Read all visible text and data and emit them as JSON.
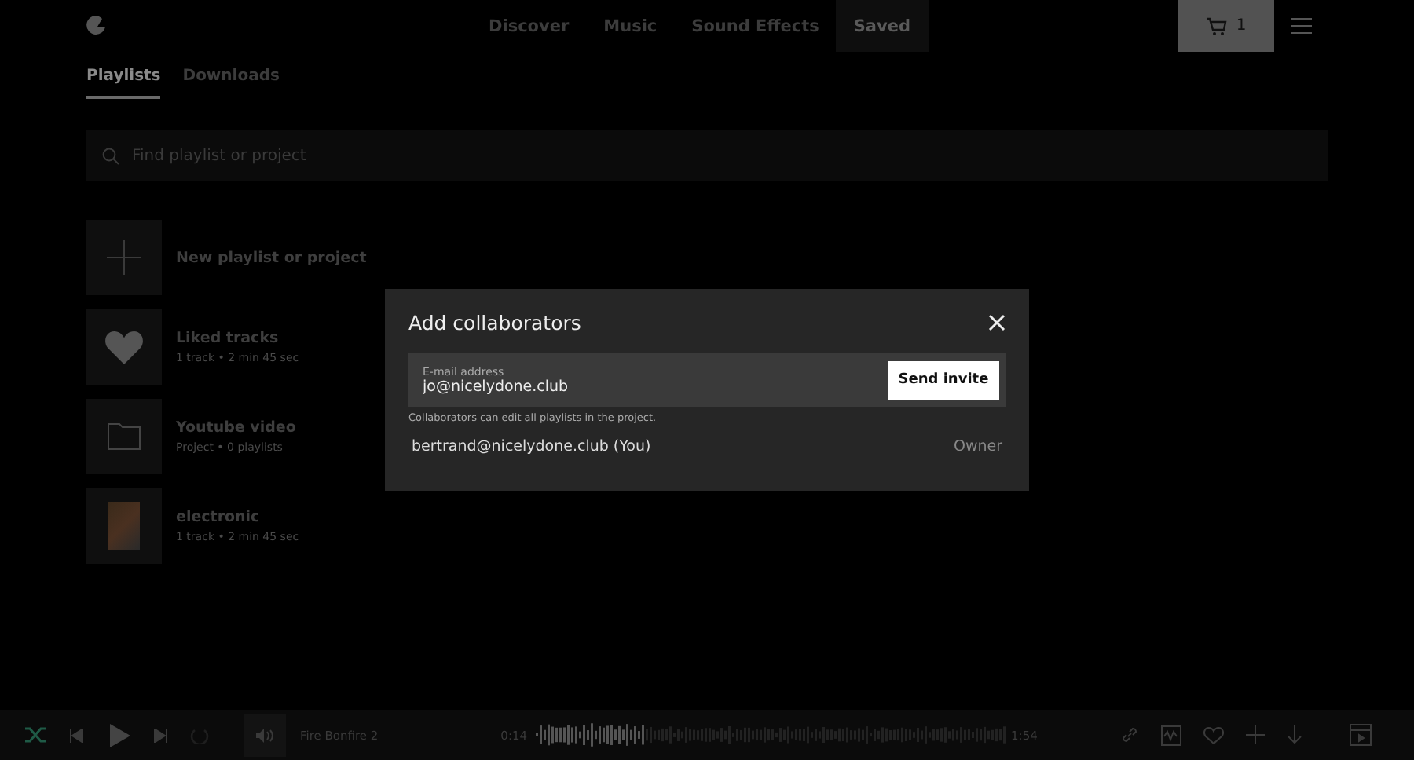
{
  "nav": [
    {
      "label": "Discover",
      "selected": false
    },
    {
      "label": "Music",
      "selected": false
    },
    {
      "label": "Sound Effects",
      "selected": false
    },
    {
      "label": "Saved",
      "selected": true
    }
  ],
  "cart": {
    "count": "1"
  },
  "tabs": [
    {
      "label": "Playlists",
      "selected": true
    },
    {
      "label": "Downloads",
      "selected": false
    }
  ],
  "search": {
    "placeholder": "Find playlist or project"
  },
  "playlists": [
    {
      "kind": "new",
      "title": "New playlist or project"
    },
    {
      "kind": "liked",
      "title": "Liked tracks",
      "meta": "1 track • 2 min 45 sec"
    },
    {
      "kind": "folder",
      "title": "Youtube video",
      "meta": "Project • 0 playlists"
    },
    {
      "kind": "cover",
      "title": "electronic",
      "meta": "1 track • 2 min 45 sec"
    }
  ],
  "dialog": {
    "title": "Add collaborators",
    "email": {
      "label": "E-mail address",
      "value": "jo@nicelydone.club"
    },
    "send": "Send invite",
    "hint": "Collaborators can edit all playlists in the project.",
    "members": [
      {
        "email": "bertrand@nicelydone.club (You)",
        "role": "Owner"
      }
    ]
  },
  "player": {
    "shuffle": {
      "on": true
    },
    "track": "Fire Bonfire 2",
    "elapsed": "0:14",
    "duration": "1:54"
  }
}
